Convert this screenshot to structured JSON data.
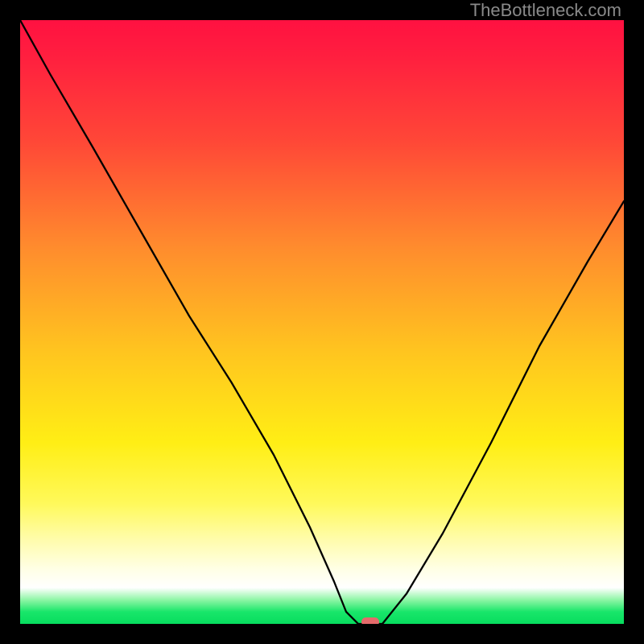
{
  "watermark": "TheBottleneck.com",
  "chart_data": {
    "type": "line",
    "title": "",
    "xlabel": "",
    "ylabel": "",
    "xlim": [
      0,
      100
    ],
    "ylim": [
      0,
      100
    ],
    "grid": false,
    "series": [
      {
        "name": "curve",
        "x": [
          0,
          5,
          12,
          20,
          28,
          35,
          42,
          48,
          52,
          54,
          56,
          58,
          60,
          64,
          70,
          78,
          86,
          94,
          100
        ],
        "y": [
          100,
          91,
          79,
          65,
          51,
          40,
          28,
          16,
          7,
          2,
          0,
          0,
          0,
          5,
          15,
          30,
          46,
          60,
          70
        ]
      }
    ],
    "marker": {
      "name": "optimum-marker",
      "x": 58,
      "y": 0,
      "color": "#e46a6a",
      "shape": "pill"
    }
  }
}
